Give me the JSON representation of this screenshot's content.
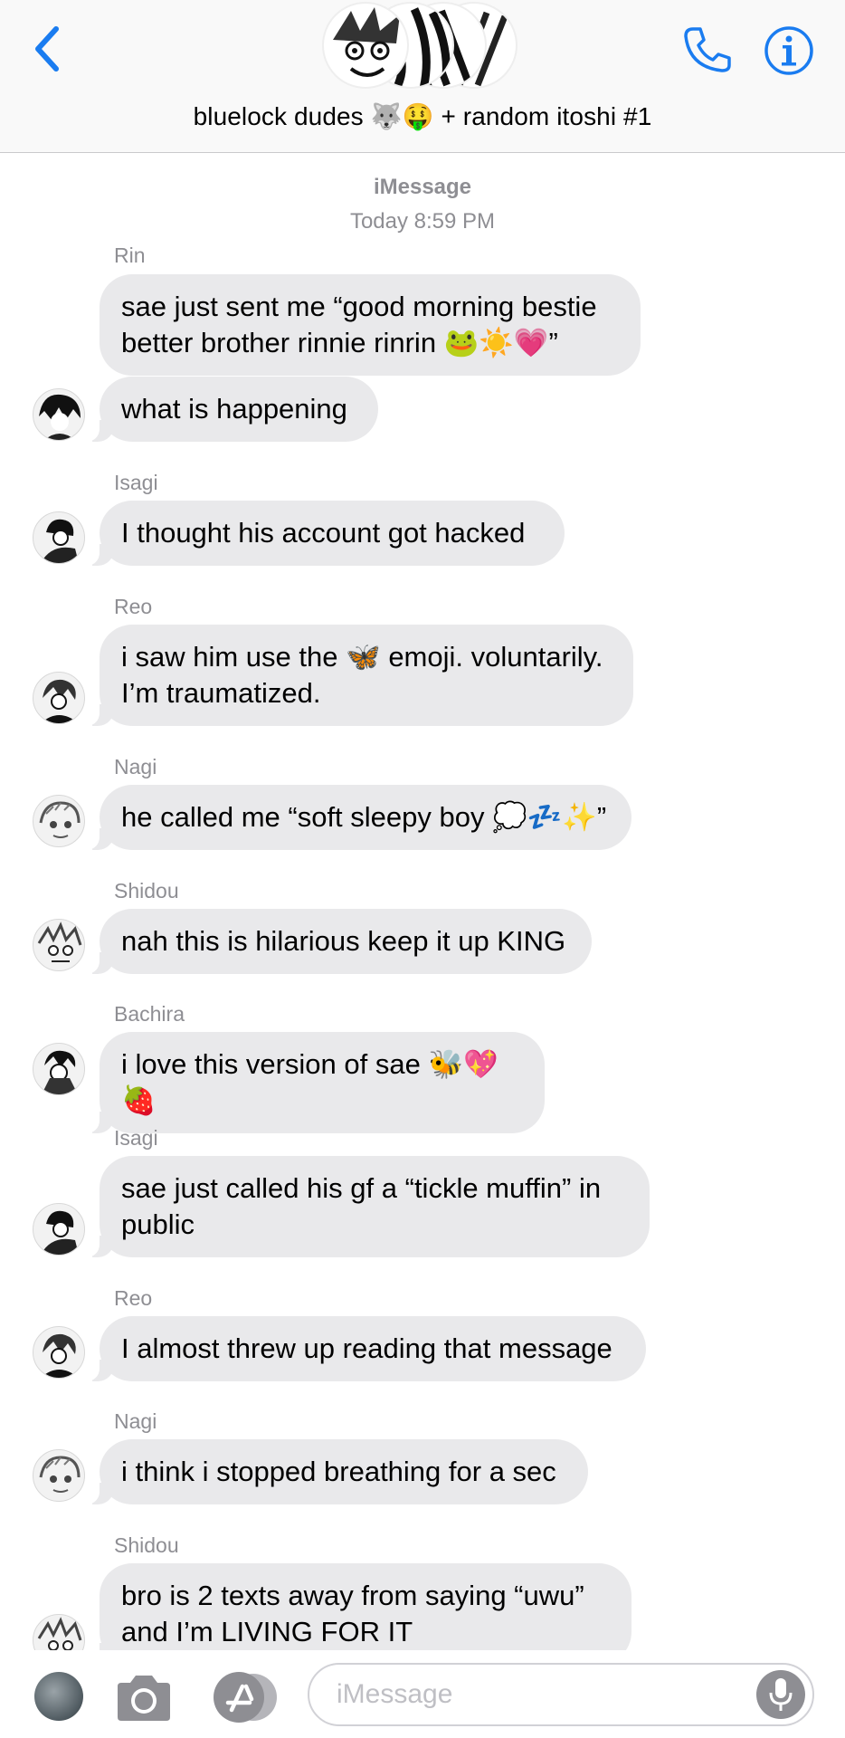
{
  "header": {
    "title": "bluelock dudes 🐺🤑 + random itoshi #1",
    "accent_color": "#1a7cf0"
  },
  "conversation": {
    "service": "iMessage",
    "timestamp": "Today 8:59 PM",
    "bubble_color": "#e9e9eb",
    "groups": [
      {
        "sender": "Rin",
        "messages": [
          "sae just sent me “good morning bestie better brother rinnie rinrin 🐸☀️💗”",
          "what is happening"
        ]
      },
      {
        "sender": "Isagi",
        "messages": [
          "I thought his account got hacked"
        ]
      },
      {
        "sender": "Reo",
        "messages": [
          "i saw him use the 🦋 emoji. voluntarily. I’m traumatized."
        ]
      },
      {
        "sender": "Nagi",
        "messages": [
          "he called me “soft sleepy boy 💭💤✨”"
        ]
      },
      {
        "sender": "Shidou",
        "messages": [
          "nah this is hilarious keep it up KING"
        ]
      },
      {
        "sender": "Bachira",
        "messages": [
          "i love this version of sae 🐝💖🍓"
        ]
      },
      {
        "sender": "Isagi",
        "messages": [
          "sae just called his gf a “tickle muffin” in public"
        ]
      },
      {
        "sender": "Reo",
        "messages": [
          "I almost threw up reading that message"
        ]
      },
      {
        "sender": "Nagi",
        "messages": [
          "i think i stopped breathing for a sec"
        ]
      },
      {
        "sender": "Shidou",
        "messages": [
          "bro is 2 texts away from saying “uwu” and I’m LIVING FOR IT"
        ]
      }
    ]
  },
  "input": {
    "placeholder": "iMessage"
  }
}
